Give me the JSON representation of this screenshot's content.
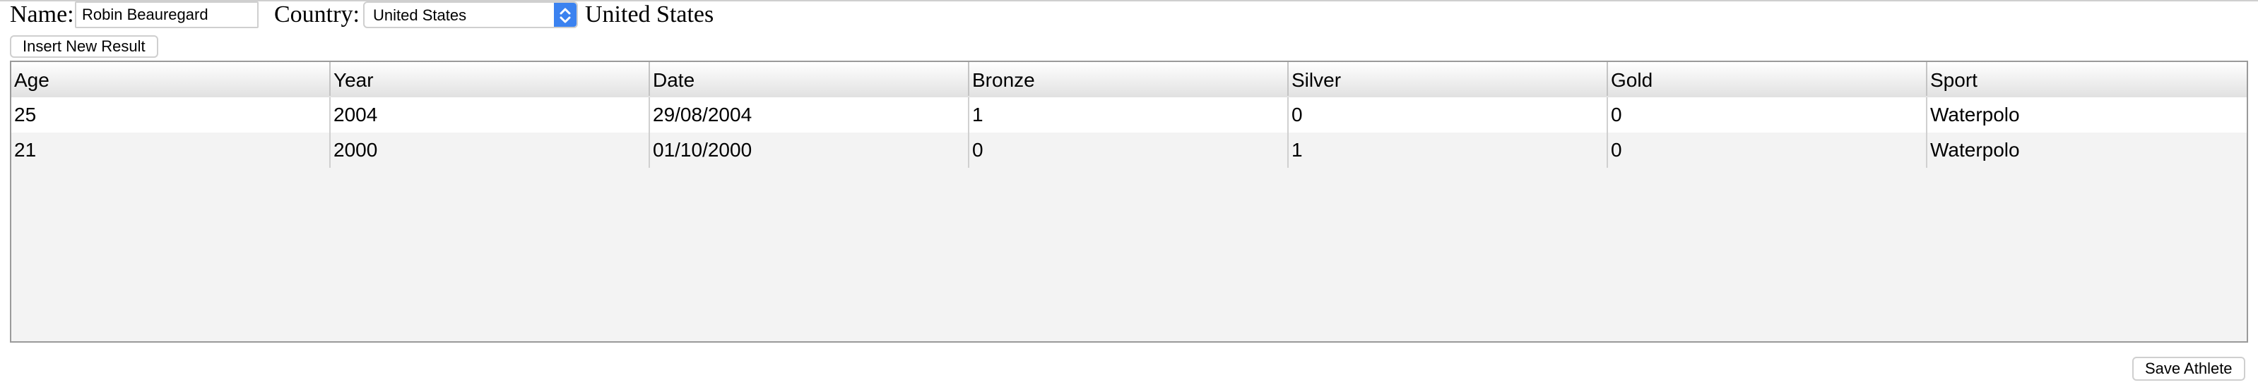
{
  "form": {
    "name_label": "Name:",
    "name_value": "Robin Beauregard",
    "country_label": "Country:",
    "country_selected": "United States",
    "country_display": "United States"
  },
  "toolbar": {
    "insert_label": "Insert New Result"
  },
  "grid": {
    "columns": [
      "Age",
      "Year",
      "Date",
      "Bronze",
      "Silver",
      "Gold",
      "Sport"
    ],
    "rows": [
      [
        "25",
        "2004",
        "29/08/2004",
        "1",
        "0",
        "0",
        "Waterpolo"
      ],
      [
        "21",
        "2000",
        "01/10/2000",
        "0",
        "1",
        "0",
        "Waterpolo"
      ]
    ]
  },
  "footer": {
    "save_label": "Save Athlete"
  },
  "colors": {
    "select_accent": "#3b82f0",
    "grid_background": "#f3f3f3"
  }
}
